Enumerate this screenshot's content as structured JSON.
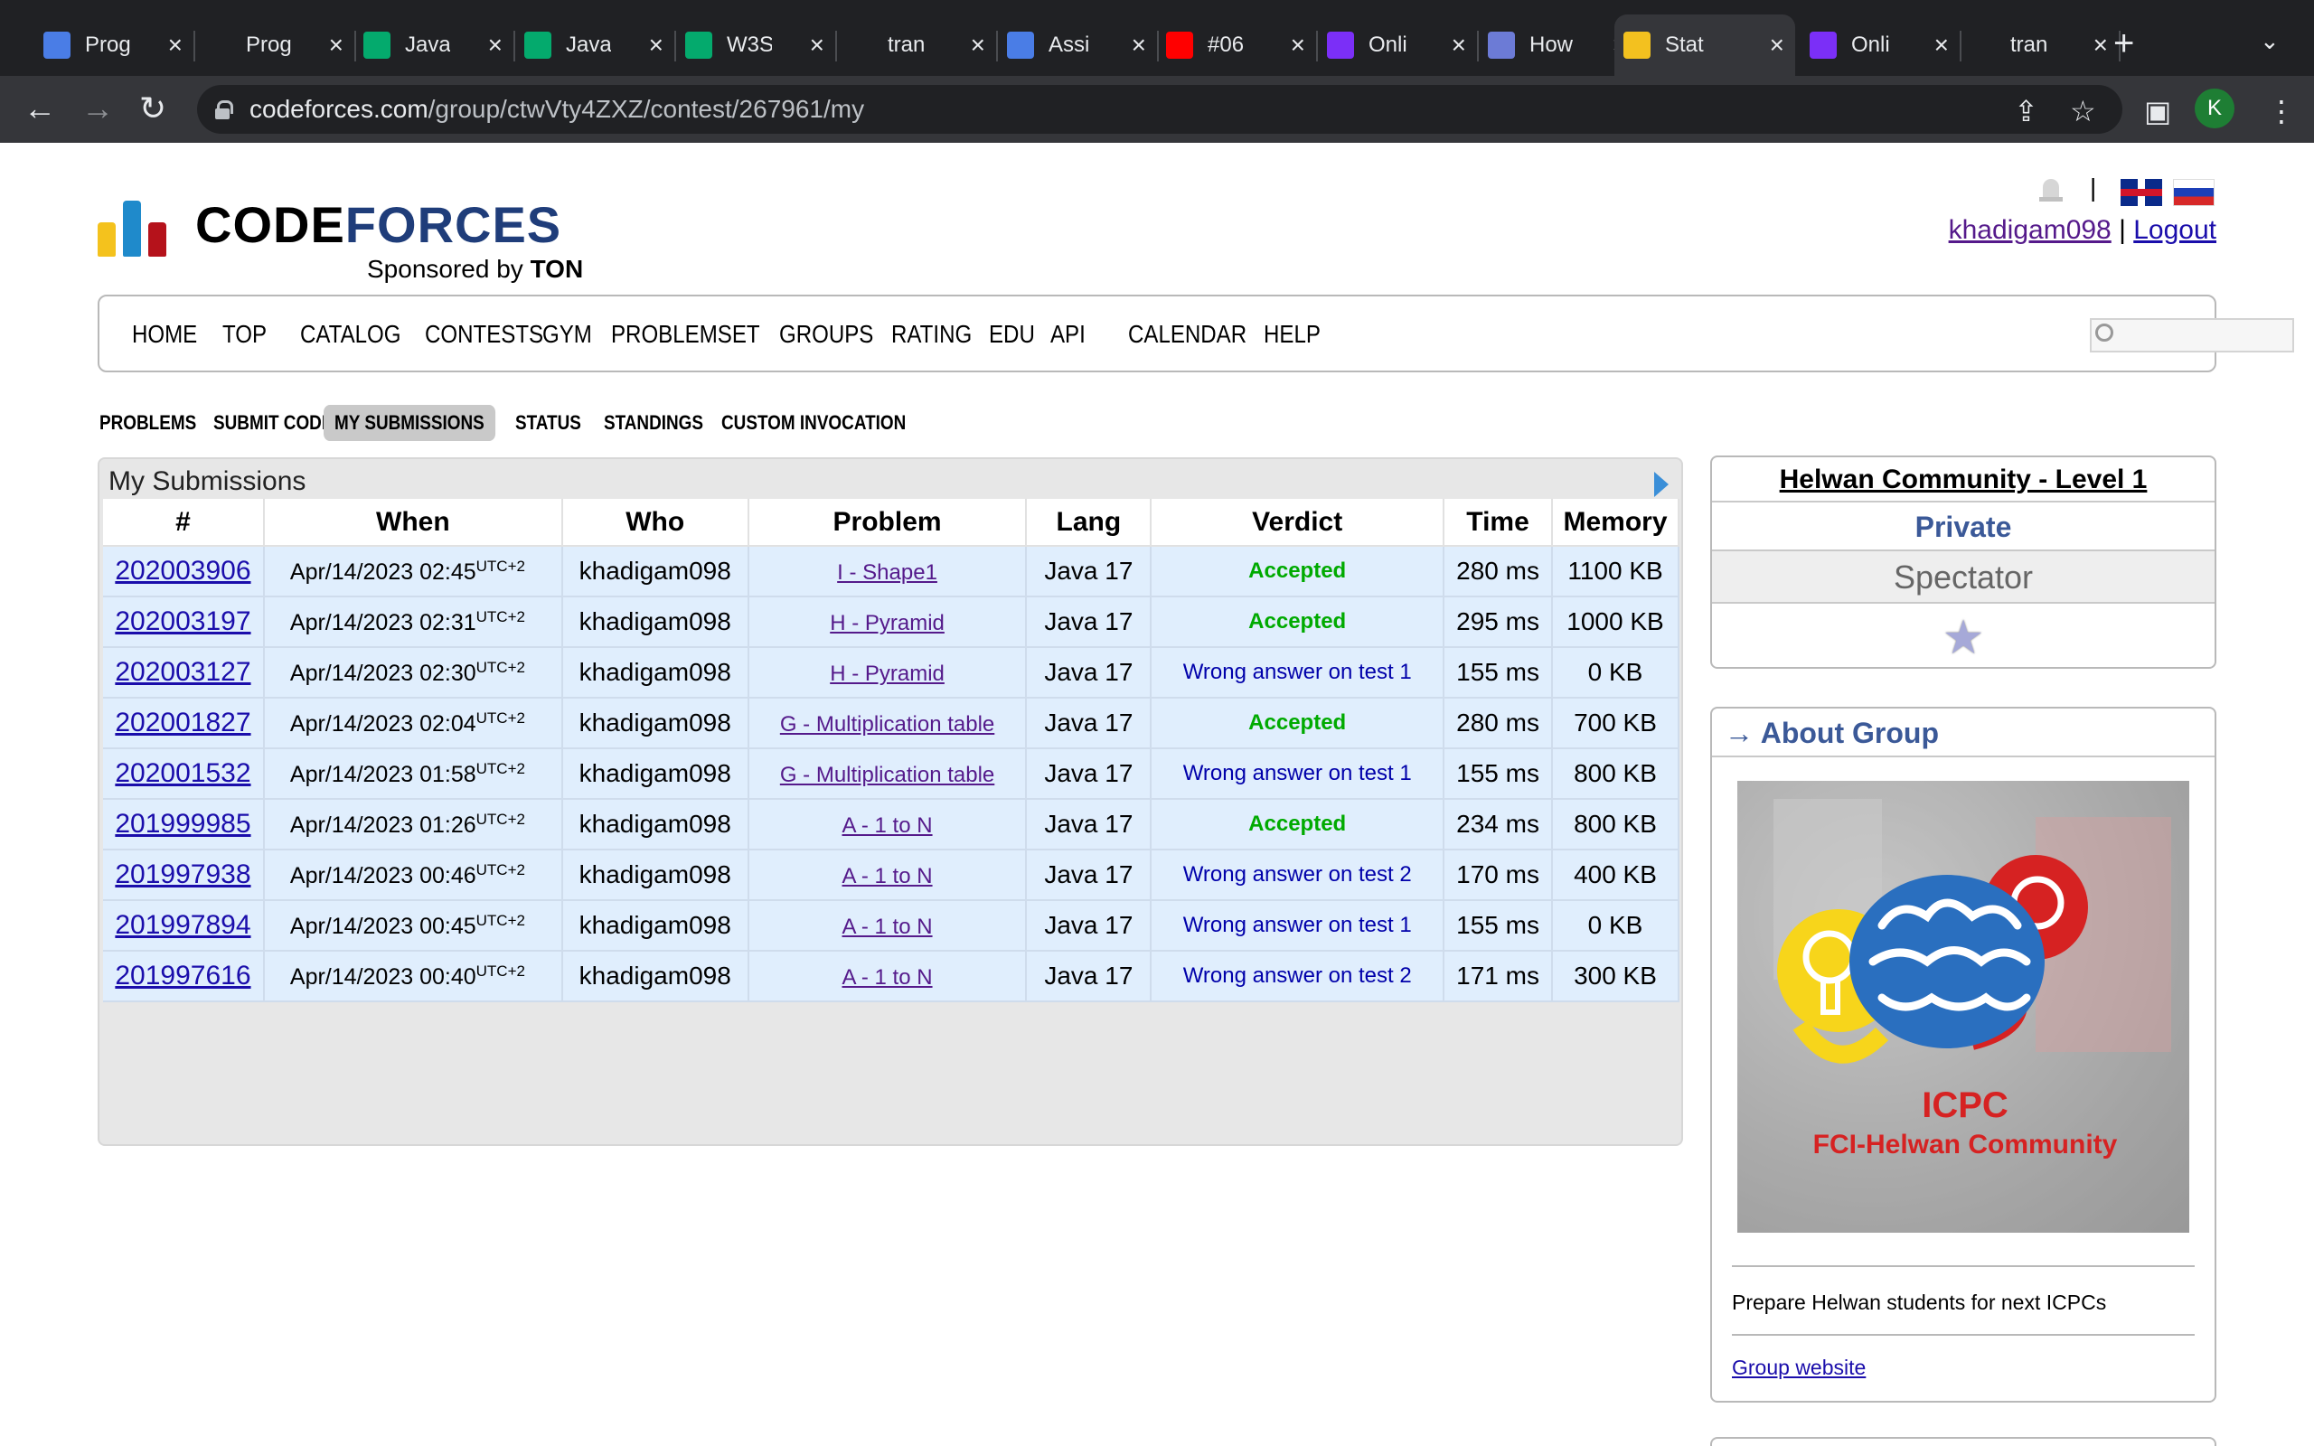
{
  "browser": {
    "tabs": [
      {
        "title": "Prog",
        "icon": "person-icon",
        "color": "#4a7de6"
      },
      {
        "title": "Prog",
        "icon": "github-icon",
        "color": "#ffffff"
      },
      {
        "title": "Java",
        "icon": "w3schools-icon",
        "color": "#04aa6d"
      },
      {
        "title": "Java",
        "icon": "w3schools-icon",
        "color": "#04aa6d"
      },
      {
        "title": "W3S",
        "icon": "w3schools-icon",
        "color": "#04aa6d"
      },
      {
        "title": "tran",
        "icon": "google-icon",
        "color": "#ffffff"
      },
      {
        "title": "Assi",
        "icon": "person-icon",
        "color": "#4a7de6"
      },
      {
        "title": "#06",
        "icon": "youtube-icon",
        "color": "#ff0000"
      },
      {
        "title": "Onli",
        "icon": "p-icon",
        "color": "#7b2ff7"
      },
      {
        "title": "How",
        "icon": "wing-icon",
        "color": "#6c7bd6"
      },
      {
        "title": "Stat",
        "icon": "codeforces-icon",
        "color": "#f3c11f"
      },
      {
        "title": "Onli",
        "icon": "p-icon",
        "color": "#7b2ff7"
      },
      {
        "title": "tran",
        "icon": "google-icon",
        "color": "#ffffff"
      }
    ],
    "new_tab": "+",
    "url_host": "codeforces.com",
    "url_path": "/group/ctwVty4ZXZ/contest/267961/my",
    "profile_initial": "K"
  },
  "header": {
    "logo_code": "CODE",
    "logo_forces": "FORCES",
    "sponsored_by": "Sponsored by",
    "sponsor_name": "TON",
    "pipe": "|",
    "username": "khadigam098",
    "separator": "|",
    "logout": "Logout"
  },
  "main_menu": [
    "HOME",
    "TOP",
    "CATALOG",
    "CONTESTS",
    "GYM",
    "PROBLEMSET",
    "GROUPS",
    "RATING",
    "EDU",
    "API",
    "CALENDAR",
    "HELP"
  ],
  "sub_menu": [
    "PROBLEMS",
    "SUBMIT CODE",
    "MY SUBMISSIONS",
    "STATUS",
    "STANDINGS",
    "CUSTOM INVOCATION"
  ],
  "submissions": {
    "title": "My Submissions",
    "columns": [
      "#",
      "When",
      "Who",
      "Problem",
      "Lang",
      "Verdict",
      "Time",
      "Memory"
    ],
    "tz": "UTC+2",
    "rows": [
      {
        "id": "202003906",
        "when": "Apr/14/2023 02:45",
        "who": "khadigam098",
        "problem": "I - Shape1",
        "lang": "Java 17",
        "verdict": "Accepted",
        "ok": true,
        "time": "280 ms",
        "memory": "1100 KB"
      },
      {
        "id": "202003197",
        "when": "Apr/14/2023 02:31",
        "who": "khadigam098",
        "problem": "H - Pyramid",
        "lang": "Java 17",
        "verdict": "Accepted",
        "ok": true,
        "time": "295 ms",
        "memory": "1000 KB"
      },
      {
        "id": "202003127",
        "when": "Apr/14/2023 02:30",
        "who": "khadigam098",
        "problem": "H - Pyramid",
        "lang": "Java 17",
        "verdict": "Wrong answer on test 1",
        "ok": false,
        "time": "155 ms",
        "memory": "0 KB"
      },
      {
        "id": "202001827",
        "when": "Apr/14/2023 02:04",
        "who": "khadigam098",
        "problem": "G - Multiplication table",
        "lang": "Java 17",
        "verdict": "Accepted",
        "ok": true,
        "time": "280 ms",
        "memory": "700 KB"
      },
      {
        "id": "202001532",
        "when": "Apr/14/2023 01:58",
        "who": "khadigam098",
        "problem": "G - Multiplication table",
        "lang": "Java 17",
        "verdict": "Wrong answer on test 1",
        "ok": false,
        "time": "155 ms",
        "memory": "800 KB"
      },
      {
        "id": "201999985",
        "when": "Apr/14/2023 01:26",
        "who": "khadigam098",
        "problem": "A - 1 to N",
        "lang": "Java 17",
        "verdict": "Accepted",
        "ok": true,
        "time": "234 ms",
        "memory": "800 KB"
      },
      {
        "id": "201997938",
        "when": "Apr/14/2023 00:46",
        "who": "khadigam098",
        "problem": "A - 1 to N",
        "lang": "Java 17",
        "verdict": "Wrong answer on test 2",
        "ok": false,
        "time": "170 ms",
        "memory": "400 KB"
      },
      {
        "id": "201997894",
        "when": "Apr/14/2023 00:45",
        "who": "khadigam098",
        "problem": "A - 1 to N",
        "lang": "Java 17",
        "verdict": "Wrong answer on test 1",
        "ok": false,
        "time": "155 ms",
        "memory": "0 KB"
      },
      {
        "id": "201997616",
        "when": "Apr/14/2023 00:40",
        "who": "khadigam098",
        "problem": "A - 1 to N",
        "lang": "Java 17",
        "verdict": "Wrong answer on test 2",
        "ok": false,
        "time": "171 ms",
        "memory": "300 KB"
      }
    ]
  },
  "sidebar": {
    "contest_name": "Helwan Community - Level 1",
    "contest_type": "Private",
    "role": "Spectator",
    "star": "★",
    "about_title": "→ About Group",
    "image_title": "ICPC",
    "image_subtitle": "FCI-Helwan Community",
    "description": "Prepare Helwan students for next ICPCs",
    "website_link": "Group website"
  },
  "colors": {
    "accepted": "#00aa00",
    "wrong": "#0000aa",
    "accent": "#3b5998"
  }
}
